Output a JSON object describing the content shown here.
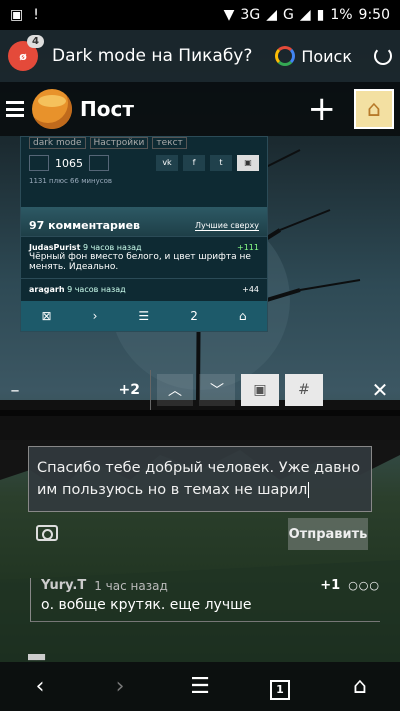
{
  "status": {
    "network": "3G",
    "network2": "G",
    "battery": "1%",
    "time": "9:50"
  },
  "browser": {
    "tab_count": "4",
    "page_title": "Dark mode на Пикабу?",
    "search_label": "Поиск"
  },
  "app": {
    "title": "Пост"
  },
  "screenshot": {
    "tags": [
      "dark mode",
      "Настройки",
      "текст"
    ],
    "votes": "1065",
    "meta": "1131 плюс 66 минусов",
    "comments_count": "97 комментариев",
    "sort": "Лучшие сверху",
    "comments": [
      {
        "author": "JudasPurist",
        "time": "9 часов назад",
        "score": "+111",
        "text": "Чёрный фон вместо белого, и цвет шрифта не менять. Идеально."
      },
      {
        "author": "aragarh",
        "time": "9 часов назад",
        "score": "+44",
        "text": ""
      }
    ],
    "nav_tabs": "2"
  },
  "toolbar": {
    "minus": "–",
    "delta": "+2",
    "hash": "#",
    "close": "✕"
  },
  "editor": {
    "text": "Спасибо тебе добрый человек. Уже давно им пользуюсь но в темах не шарил"
  },
  "send": {
    "label": "Отправить"
  },
  "comment": {
    "author": "Yury.T",
    "time": "1 час назад",
    "score": "+1",
    "text": "о. вобще крутяк. еще лучше"
  },
  "navbar": {
    "tab_count": "1"
  }
}
